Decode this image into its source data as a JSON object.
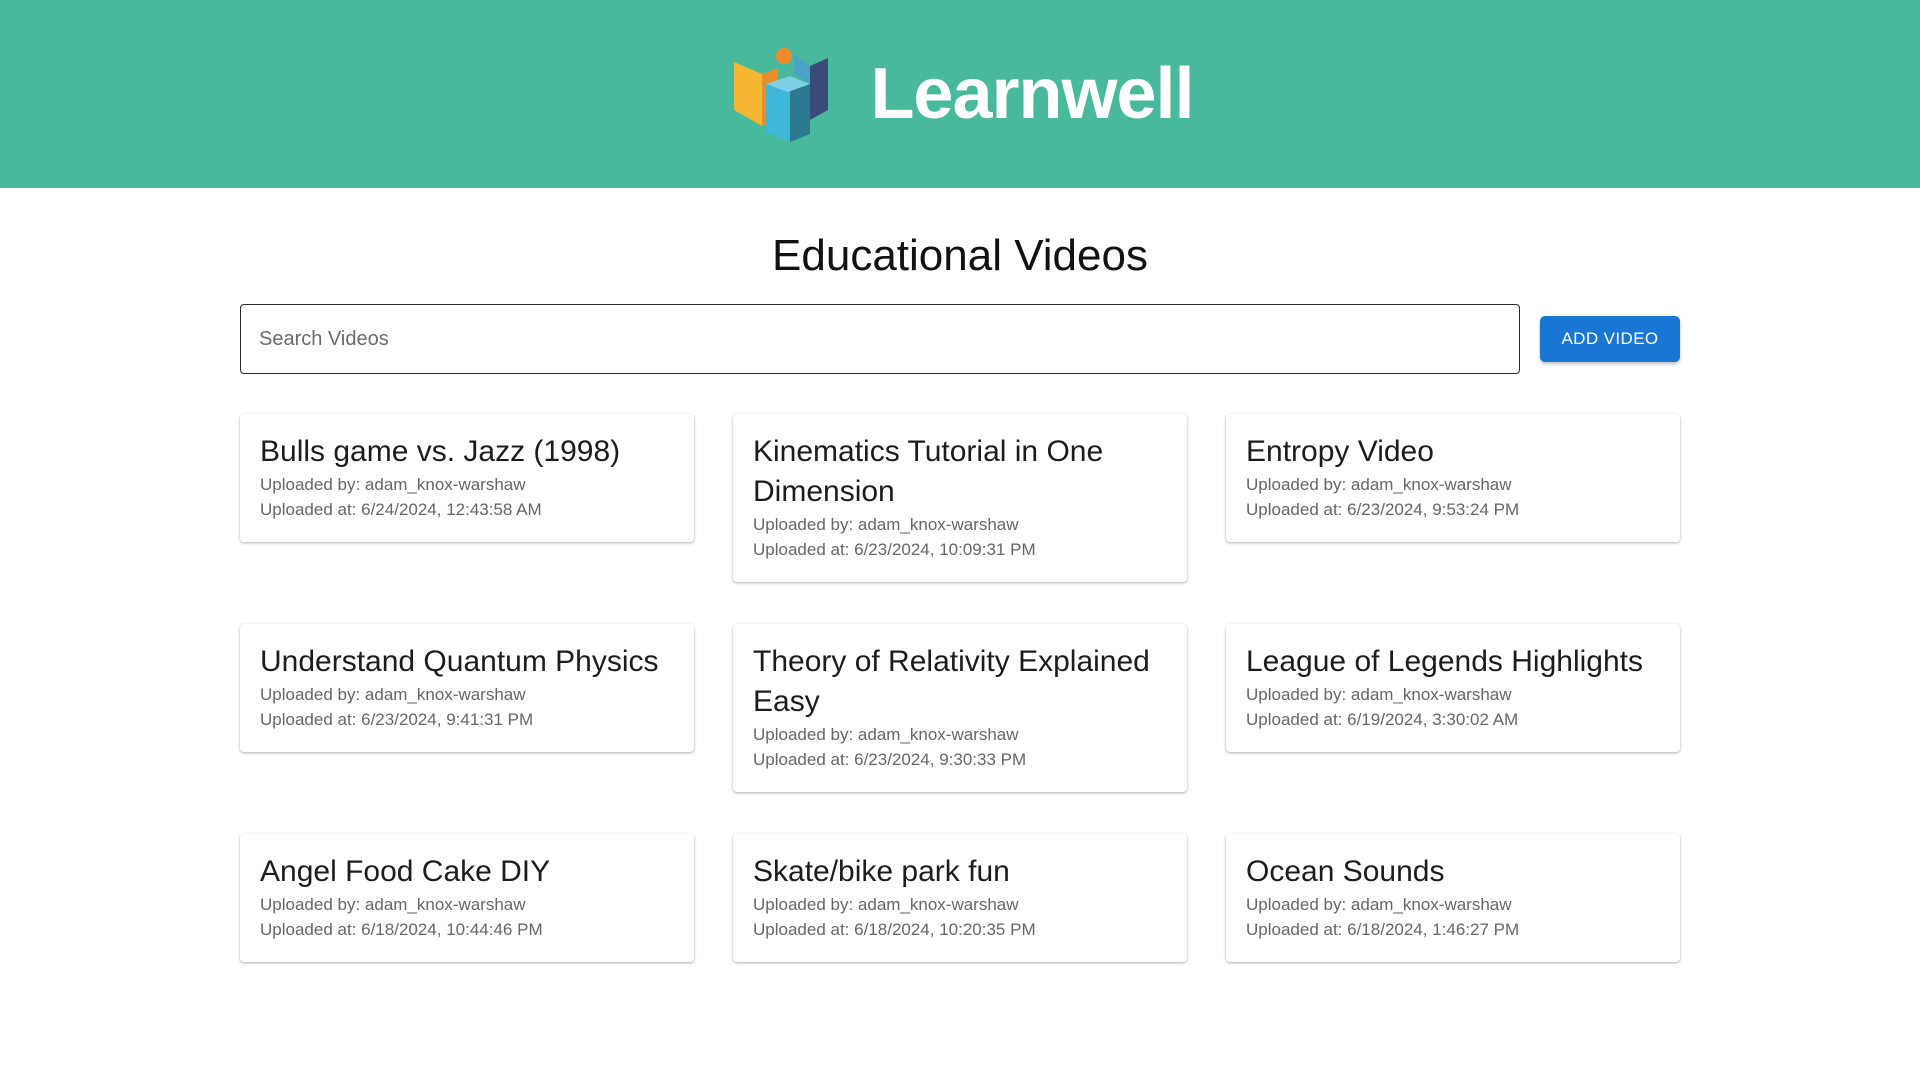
{
  "colors": {
    "header_bg": "#48b99a",
    "accent": "#1976d2"
  },
  "header": {
    "brand_name": "Learnwell",
    "logo_icon": "learnwell-logo-icon"
  },
  "main": {
    "title": "Educational Videos",
    "search": {
      "placeholder": "Search Videos",
      "value": ""
    },
    "add_button_label": "ADD VIDEO",
    "videos": [
      {
        "title": "Bulls game vs. Jazz (1998)",
        "uploaded_by": "Uploaded by: adam_knox-warshaw",
        "uploaded_at": "Uploaded at: 6/24/2024, 12:43:58 AM"
      },
      {
        "title": "Kinematics Tutorial in One Dimension",
        "uploaded_by": "Uploaded by: adam_knox-warshaw",
        "uploaded_at": "Uploaded at: 6/23/2024, 10:09:31 PM"
      },
      {
        "title": "Entropy Video",
        "uploaded_by": "Uploaded by: adam_knox-warshaw",
        "uploaded_at": "Uploaded at: 6/23/2024, 9:53:24 PM"
      },
      {
        "title": "Understand Quantum Physics",
        "uploaded_by": "Uploaded by: adam_knox-warshaw",
        "uploaded_at": "Uploaded at: 6/23/2024, 9:41:31 PM"
      },
      {
        "title": "Theory of Relativity Explained Easy",
        "uploaded_by": "Uploaded by: adam_knox-warshaw",
        "uploaded_at": "Uploaded at: 6/23/2024, 9:30:33 PM"
      },
      {
        "title": "League of Legends Highlights",
        "uploaded_by": "Uploaded by: adam_knox-warshaw",
        "uploaded_at": "Uploaded at: 6/19/2024, 3:30:02 AM"
      },
      {
        "title": "Angel Food Cake DIY",
        "uploaded_by": "Uploaded by: adam_knox-warshaw",
        "uploaded_at": "Uploaded at: 6/18/2024, 10:44:46 PM"
      },
      {
        "title": "Skate/bike park fun",
        "uploaded_by": "Uploaded by: adam_knox-warshaw",
        "uploaded_at": "Uploaded at: 6/18/2024, 10:20:35 PM"
      },
      {
        "title": "Ocean Sounds",
        "uploaded_by": "Uploaded by: adam_knox-warshaw",
        "uploaded_at": "Uploaded at: 6/18/2024, 1:46:27 PM"
      }
    ]
  }
}
